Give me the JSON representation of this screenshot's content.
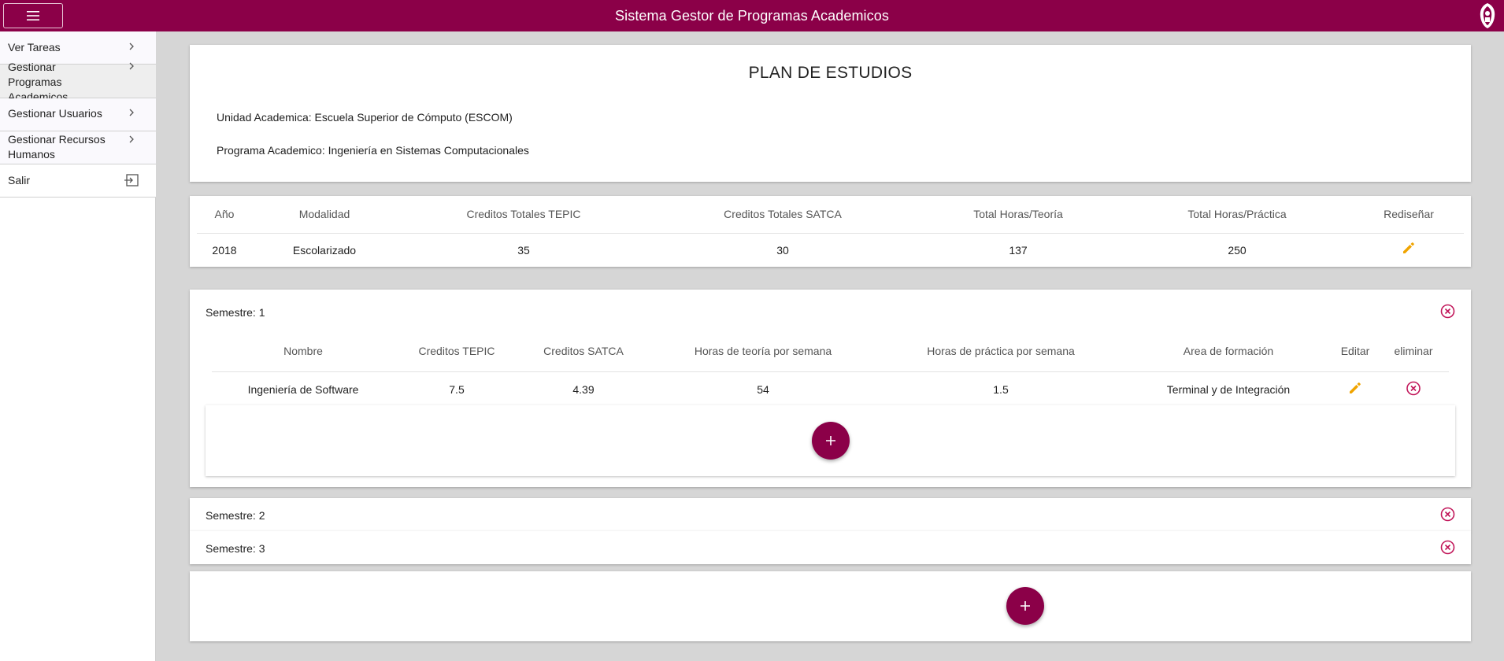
{
  "app": {
    "title": "Sistema Gestor de Programas Academicos",
    "brand_color": "#8b0048",
    "accent_color": "#f0a400",
    "danger_color": "#c2185b"
  },
  "sidebar": {
    "items": [
      {
        "label": "Ver Tareas",
        "icon": "chevron-right-icon"
      },
      {
        "label": "Gestionar Programas Academicos",
        "icon": "chevron-right-icon"
      },
      {
        "label": "Gestionar Usuarios",
        "icon": "chevron-right-icon"
      },
      {
        "label": "Gestionar Recursos Humanos",
        "icon": "chevron-right-icon"
      },
      {
        "label": "Salir",
        "icon": "exit-icon"
      }
    ]
  },
  "plan": {
    "title": "PLAN DE ESTUDIOS",
    "unidad": "Unidad Academica: Escuela Superior de Cómputo (ESCOM)",
    "programa": "Programa Academico: Ingeniería en Sistemas Computacionales"
  },
  "summary": {
    "headers": [
      "Año",
      "Modalidad",
      "Creditos Totales TEPIC",
      "Creditos Totales SATCA",
      "Total Horas/Teoría",
      "Total Horas/Práctica",
      "Rediseñar"
    ],
    "row": {
      "anio": "2018",
      "modalidad": "Escolarizado",
      "tepic": "35",
      "satca": "30",
      "teoria": "137",
      "practica": "250"
    }
  },
  "semesters": [
    {
      "title": "Semestre: 1",
      "headers": [
        "Nombre",
        "Creditos TEPIC",
        "Creditos SATCA",
        "Horas de teoría por semana",
        "Horas de práctica por semana",
        "Area de formación",
        "Editar",
        "eliminar"
      ],
      "subjects": [
        {
          "nombre": "Ingeniería de Software",
          "tepic": "7.5",
          "satca": "4.39",
          "teoria": "54",
          "practica": "1.5",
          "area": "Terminal y de Integración"
        }
      ]
    },
    {
      "title": "Semestre: 2"
    },
    {
      "title": "Semestre: 3"
    }
  ]
}
